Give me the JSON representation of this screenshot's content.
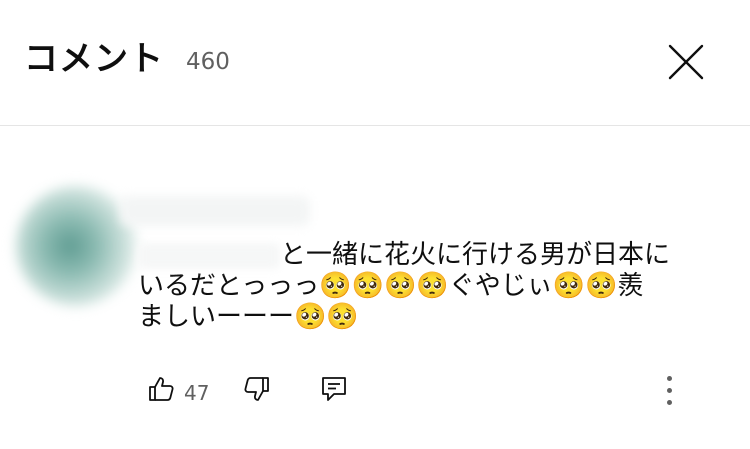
{
  "header": {
    "title": "コメント",
    "count": "460"
  },
  "comment": {
    "text_line1_suffix": "と一緒に花火に行ける男が日本に",
    "text_line2": "いるだとっっっ🥺🥺🥺🥺ぐやじぃ🥺🥺羨",
    "text_line3": "ましいーーー🥺🥺",
    "like_count": "47"
  },
  "icons": {
    "close": "close-icon",
    "like": "thumbs-up-icon",
    "dislike": "thumbs-down-icon",
    "reply": "reply-icon",
    "more": "more-vertical-icon"
  }
}
